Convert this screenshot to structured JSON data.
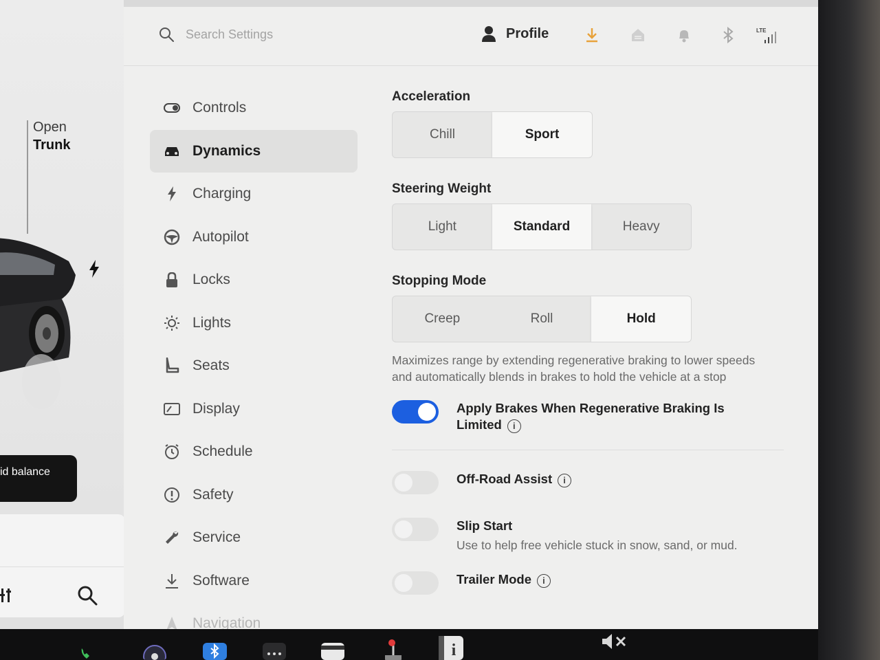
{
  "car_view": {
    "open_trunk_line1": "Open",
    "open_trunk_line2": "Trunk",
    "balance_text": "id balance"
  },
  "topbar": {
    "search_placeholder": "Search Settings",
    "profile_label": "Profile",
    "icons": [
      "download-icon",
      "homelink-icon",
      "bell-icon",
      "bluetooth-icon",
      "lte-signal-icon"
    ],
    "lte_label": "LTE",
    "download_color": "#e8a23a"
  },
  "nav": {
    "items": [
      {
        "label": "Controls",
        "icon": "toggle-icon"
      },
      {
        "label": "Dynamics",
        "icon": "car-icon",
        "active": true
      },
      {
        "label": "Charging",
        "icon": "bolt-icon"
      },
      {
        "label": "Autopilot",
        "icon": "steering-wheel-icon"
      },
      {
        "label": "Locks",
        "icon": "lock-icon"
      },
      {
        "label": "Lights",
        "icon": "sun-icon"
      },
      {
        "label": "Seats",
        "icon": "seat-icon"
      },
      {
        "label": "Display",
        "icon": "display-icon"
      },
      {
        "label": "Schedule",
        "icon": "alarm-clock-icon"
      },
      {
        "label": "Safety",
        "icon": "alert-circle-icon"
      },
      {
        "label": "Service",
        "icon": "wrench-icon"
      },
      {
        "label": "Software",
        "icon": "download-icon"
      },
      {
        "label": "Navigation",
        "icon": "navigation-icon"
      }
    ]
  },
  "dynamics": {
    "acceleration": {
      "title": "Acceleration",
      "options": [
        "Chill",
        "Sport"
      ],
      "selected": "Sport"
    },
    "steering_weight": {
      "title": "Steering Weight",
      "options": [
        "Light",
        "Standard",
        "Heavy"
      ],
      "selected": "Standard"
    },
    "stopping_mode": {
      "title": "Stopping Mode",
      "options": [
        "Creep",
        "Roll",
        "Hold"
      ],
      "selected": "Hold",
      "description": "Maximizes range by extending regenerative braking to lower speeds and automatically blends in brakes to hold the vehicle at a stop"
    },
    "apply_brakes": {
      "label": "Apply Brakes When Regenerative Braking Is Limited",
      "enabled": true
    },
    "off_road_assist": {
      "label": "Off-Road Assist",
      "enabled": false
    },
    "slip_start": {
      "label": "Slip Start",
      "sublabel": "Use to help free vehicle stuck in snow, sand, or mud.",
      "enabled": false
    },
    "trailer_mode": {
      "label": "Trailer Mode",
      "enabled": false
    },
    "accent_color": "#1c5fe0"
  },
  "taskbar": {
    "icons": [
      "phone-icon",
      "camera-icon",
      "bluetooth-app-icon",
      "more-apps-icon",
      "calendar-icon",
      "joystick-icon",
      "info-app-icon",
      "volume-muted-icon"
    ]
  }
}
